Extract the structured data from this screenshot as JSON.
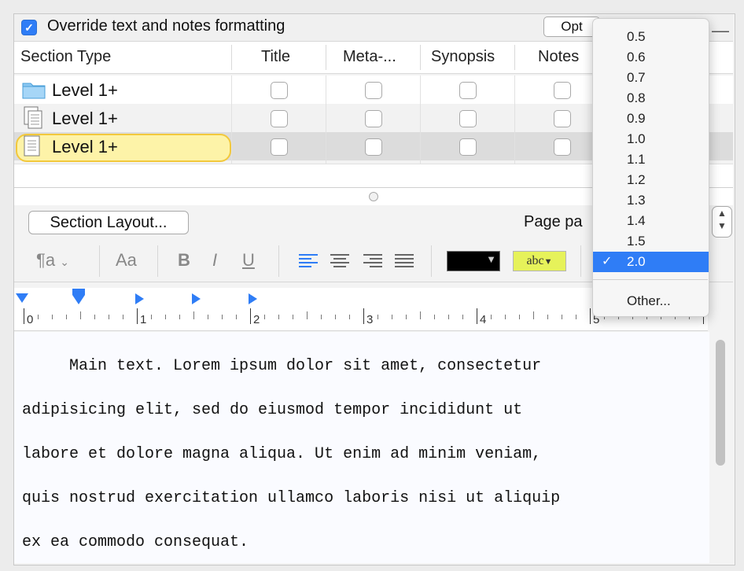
{
  "override": {
    "label": "Override text and notes formatting",
    "checked": true
  },
  "options_button": "Opt",
  "table": {
    "headers": [
      "Section Type",
      "Title",
      "Meta-...",
      "Synopsis",
      "Notes"
    ],
    "rows": [
      {
        "icon": "folder-icon",
        "label": "Level  1+"
      },
      {
        "icon": "document-stack-icon",
        "label": "Level  1+"
      },
      {
        "icon": "document-icon",
        "label": "Level  1+"
      }
    ]
  },
  "section_layout_label": "Section Layout...",
  "page_label": "Page pa",
  "toolbar": {
    "paragraph_style": "¶a",
    "font_button": "Aa",
    "bold": "B",
    "italic": "I",
    "underline": "U",
    "text_color": "#000000",
    "highlight_label": "abc",
    "highlight_color": "#e6f25a"
  },
  "ruler": {
    "numbers": [
      "0",
      "1",
      "2",
      "3",
      "4",
      "5"
    ]
  },
  "body_text": [
    "     Main text. Lorem ipsum dolor sit amet, consectetur",
    "adipisicing elit, sed do eiusmod tempor incididunt ut",
    "labore et dolore magna aliqua. Ut enim ad minim veniam,",
    "quis nostrud exercitation ullamco laboris nisi ut aliquip",
    "ex ea commodo consequat."
  ],
  "zoom_menu": {
    "items": [
      "0.5",
      "0.6",
      "0.7",
      "0.8",
      "0.9",
      "1.0",
      "1.1",
      "1.2",
      "1.3",
      "1.4",
      "1.5",
      "2.0"
    ],
    "selected": "2.0",
    "check": "✓",
    "other": "Other..."
  },
  "colors": {
    "accent": "#2f7df6",
    "row_highlight": "#fdf3a8",
    "row_highlight_border": "#f2c83c"
  }
}
